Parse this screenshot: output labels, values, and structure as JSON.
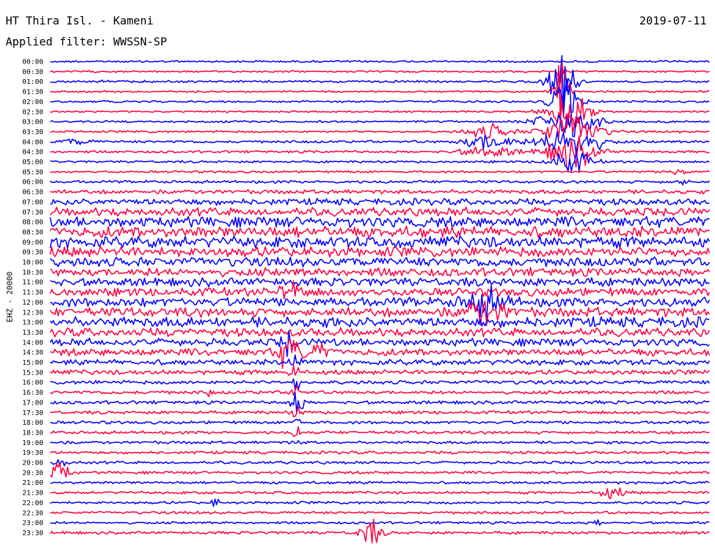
{
  "header": {
    "station": "HT Thira Isl. - Kameni",
    "date": "2019-07-11",
    "filter": "Applied filter: WWSSN-SP"
  },
  "chart_data": {
    "type": "helicorder",
    "ylabel": "EHZ - 20000",
    "time_labels": [
      "00:00",
      "00:30",
      "01:00",
      "01:30",
      "02:00",
      "02:30",
      "03:00",
      "03:30",
      "04:00",
      "04:30",
      "05:00",
      "05:30",
      "06:00",
      "06:30",
      "07:00",
      "07:30",
      "08:00",
      "08:30",
      "09:00",
      "09:30",
      "10:00",
      "10:30",
      "11:00",
      "11:30",
      "12:00",
      "12:30",
      "13:00",
      "13:30",
      "14:00",
      "14:30",
      "15:00",
      "15:30",
      "16:00",
      "16:30",
      "17:00",
      "17:30",
      "18:00",
      "18:30",
      "19:00",
      "19:30",
      "20:00",
      "20:30",
      "21:00",
      "21:30",
      "22:00",
      "22:30",
      "23:00",
      "23:30"
    ],
    "trace_colors": [
      "#0000ff",
      "#ff0040"
    ],
    "noise_level": [
      1.1,
      1.0,
      1.2,
      1.0,
      1.1,
      1.0,
      1.1,
      1.1,
      1.4,
      1.3,
      1.2,
      1.2,
      1.5,
      2.2,
      3.5,
      4.5,
      5.5,
      6.0,
      6.0,
      5.5,
      5.0,
      4.5,
      4.5,
      4.5,
      5.0,
      5.0,
      5.5,
      4.5,
      4.0,
      3.8,
      3.0,
      2.5,
      2.0,
      1.8,
      1.8,
      1.7,
      1.6,
      1.6,
      1.5,
      1.5,
      1.5,
      1.4,
      1.4,
      1.4,
      1.4,
      1.4,
      1.3,
      1.5
    ],
    "events": [
      {
        "line": 1,
        "time": 0.775,
        "amp": 45,
        "width": 0.004
      },
      {
        "line": 2,
        "time": 0.775,
        "amp": 30,
        "width": 0.02
      },
      {
        "line": 2,
        "time": 0.08,
        "amp": 2,
        "width": 0.005
      },
      {
        "line": 3,
        "time": 0.775,
        "amp": 40,
        "width": 0.012
      },
      {
        "line": 4,
        "time": 0.78,
        "amp": 28,
        "width": 0.02
      },
      {
        "line": 5,
        "time": 0.785,
        "amp": 22,
        "width": 0.03
      },
      {
        "line": 6,
        "time": 0.785,
        "amp": 18,
        "width": 0.04
      },
      {
        "line": 7,
        "time": 0.665,
        "amp": 8,
        "width": 0.03
      },
      {
        "line": 7,
        "time": 0.79,
        "amp": 20,
        "width": 0.04
      },
      {
        "line": 8,
        "time": 0.665,
        "amp": 10,
        "width": 0.035
      },
      {
        "line": 8,
        "time": 0.79,
        "amp": 20,
        "width": 0.04
      },
      {
        "line": 8,
        "time": 0.04,
        "amp": 3,
        "width": 0.02
      },
      {
        "line": 9,
        "time": 0.665,
        "amp": 6,
        "width": 0.04
      },
      {
        "line": 9,
        "time": 0.79,
        "amp": 18,
        "width": 0.035
      },
      {
        "line": 10,
        "time": 0.79,
        "amp": 12,
        "width": 0.03
      },
      {
        "line": 11,
        "time": 0.955,
        "amp": 7,
        "width": 0.01
      },
      {
        "line": 12,
        "time": 0.955,
        "amp": 4,
        "width": 0.01
      },
      {
        "line": 23,
        "time": 0.365,
        "amp": 10,
        "width": 0.015
      },
      {
        "line": 24,
        "time": 0.66,
        "amp": 14,
        "width": 0.03
      },
      {
        "line": 25,
        "time": 0.66,
        "amp": 12,
        "width": 0.03
      },
      {
        "line": 28,
        "time": 0.36,
        "amp": 12,
        "width": 0.01
      },
      {
        "line": 29,
        "time": 0.36,
        "amp": 16,
        "width": 0.015
      },
      {
        "line": 29,
        "time": 0.4,
        "amp": 8,
        "width": 0.02
      },
      {
        "line": 30,
        "time": 0.37,
        "amp": 7,
        "width": 0.01
      },
      {
        "line": 31,
        "time": 0.37,
        "amp": 9,
        "width": 0.008
      },
      {
        "line": 32,
        "time": 0.372,
        "amp": 12,
        "width": 0.006
      },
      {
        "line": 33,
        "time": 0.372,
        "amp": 16,
        "width": 0.006
      },
      {
        "line": 34,
        "time": 0.374,
        "amp": 18,
        "width": 0.008
      },
      {
        "line": 35,
        "time": 0.374,
        "amp": 9,
        "width": 0.006
      },
      {
        "line": 36,
        "time": 0.374,
        "amp": 9,
        "width": 0.005
      },
      {
        "line": 37,
        "time": 0.374,
        "amp": 7,
        "width": 0.005
      },
      {
        "line": 38,
        "time": 0.374,
        "amp": 5,
        "width": 0.005
      },
      {
        "line": 33,
        "time": 0.24,
        "amp": 5,
        "width": 0.004
      },
      {
        "line": 41,
        "time": 0.015,
        "amp": 14,
        "width": 0.012
      },
      {
        "line": 40,
        "time": 0.015,
        "amp": 8,
        "width": 0.008
      },
      {
        "line": 43,
        "time": 0.85,
        "amp": 6,
        "width": 0.02
      },
      {
        "line": 44,
        "time": 0.25,
        "amp": 9,
        "width": 0.004
      },
      {
        "line": 46,
        "time": 0.83,
        "amp": 7,
        "width": 0.003
      },
      {
        "line": 47,
        "time": 0.485,
        "amp": 14,
        "width": 0.016
      }
    ]
  }
}
